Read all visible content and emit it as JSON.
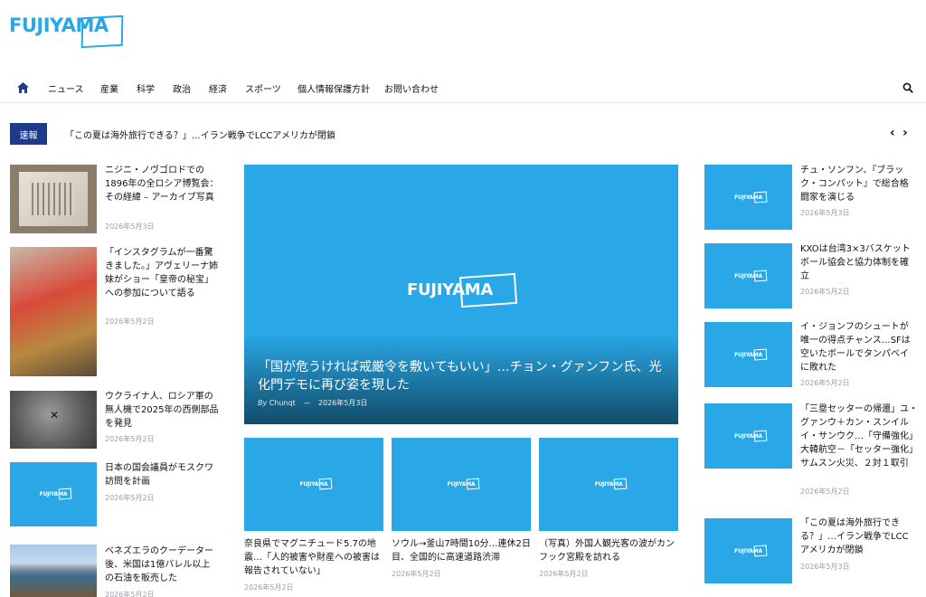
{
  "site": {
    "logo": "FUJIYAMA"
  },
  "nav": {
    "items": [
      "ニュース",
      "産業",
      "科学",
      "政治",
      "経済",
      "スポーツ",
      "個人情報保護方針",
      "お問い合わせ"
    ]
  },
  "ticker": {
    "badge": "速報",
    "text": "「この夏は海外旅行できる？」…イラン戦争でLCCアメリカが閉鎖",
    "prev": "‹",
    "next": "›"
  },
  "left_articles": [
    {
      "title": "ニジニ・ノヴゴロドでの1896年の全ロシア博覧会：その経緯 – アーカイブ写真",
      "date": "2026年5月3日"
    },
    {
      "title": "「インスタグラムが一番驚きました。」アヴェリーナ姉妹がショー「皇帝の秘宝」への参加について語る",
      "date": "2026年5月2日"
    },
    {
      "title": "ウクライナ人、ロシア軍の無人機で2025年の西側部品を発見",
      "date": "2026年5月2日"
    },
    {
      "title": "日本の国会議員がモスクワ訪問を計画",
      "date": "2026年5月2日"
    },
    {
      "title": "ベネズエラのクーデーター後、米国は1億バレル以上の石油を販売した",
      "date": "2026年5月2日"
    }
  ],
  "hero": {
    "logo": "FUJIYAMA",
    "title": "「国が危うければ戒厳令を敷いてもいい」…チョン・グァンフン氏、光化門デモに再び姿を現した",
    "by": "By",
    "author": "Chunqt",
    "sep": "—",
    "date": "2026年5月3日"
  },
  "bottom_articles": [
    {
      "title": "奈良県でマグニチュード5.7の地震…「人的被害や財産への被害は報告されていない」",
      "date": "2026年5月2日"
    },
    {
      "title": "ソウル→釜山7時間10分…連休2日目、全国的に高速道路渋滞",
      "date": "2026年5月2日"
    },
    {
      "title": "（写真）外国人観光客の波がカンフック宮殿を訪れる",
      "date": "2026年5月2日"
    }
  ],
  "right_articles": [
    {
      "title": "チュ・ソンフン、『ブラック・コンパット』で総合格闘家を演じる",
      "date": "2026年5月3日"
    },
    {
      "title": "KXOは台湾3×3バスケットボール協会と協力体制を確立",
      "date": "2026年5月2日"
    },
    {
      "title": "イ・ジョンフのシュートが唯一の得点チャンス…SFは空いたボールでタンパベイに敗れた",
      "date": "2026年5月2日"
    },
    {
      "title": "「三塁セッターの帰還」ユ・グァンウ＋カン・スンイル イ・サンウク…「守備強化」大韓航空－「セッター強化」サムスン火災、２対１取引",
      "date": "2026年5月2日"
    },
    {
      "title": "「この夏は海外旅行できる？」…イラン戦争でLCCアメリカが閉鎖",
      "date": "2026年5月3日"
    }
  ],
  "thumb_logo": "FUJIYAMA",
  "colors": {
    "brand": "#29a7e6",
    "badge": "#1e3a8a"
  }
}
